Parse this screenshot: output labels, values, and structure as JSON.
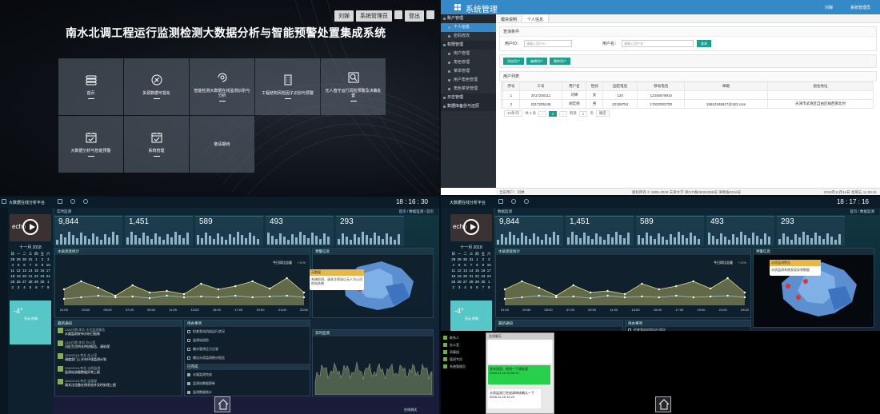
{
  "portal": {
    "user": "刘婵",
    "admin_button": "系统管理员",
    "logout": "登出",
    "title": "南水北调工程运行监测检测大数据分析与智能预警处置集成系统",
    "tiles": [
      {
        "label": "首页",
        "icon": "server-icon"
      },
      {
        "label": "多源数据可视化",
        "icon": "satellite-icon"
      },
      {
        "label": "智能检测大数据在线监测识别与分析",
        "icon": "refresh-eye-icon"
      },
      {
        "label": "工程结构风险因子识别与预警",
        "icon": "building-icon"
      },
      {
        "label": "无人值守运行风险预警及决策处置",
        "icon": "search-icon"
      },
      {
        "label": "大数据分析与智能预警",
        "icon": "calendar-check-icon"
      },
      {
        "label": "系统管理",
        "icon": "calendar-check-icon"
      },
      {
        "label": "敬请期待",
        "icon": ""
      }
    ]
  },
  "admin": {
    "app_title": "系统管理",
    "user": "刘婵",
    "system_admin": "系统管理员",
    "sidebar": [
      {
        "label": "账户管理",
        "type": "group"
      },
      {
        "label": "个人信息",
        "type": "active"
      },
      {
        "label": "密码修改",
        "type": "item"
      },
      {
        "label": "权限管理",
        "type": "group"
      },
      {
        "label": "用户管理",
        "type": "item"
      },
      {
        "label": "角色管理",
        "type": "item"
      },
      {
        "label": "菜单管理",
        "type": "item"
      },
      {
        "label": "用户角色管理",
        "type": "item"
      },
      {
        "label": "角色菜单管理",
        "type": "item"
      },
      {
        "label": "日志管理",
        "type": "group"
      },
      {
        "label": "数据库备份与还原",
        "type": "group"
      }
    ],
    "tabs": [
      "模块说明",
      "个人信息"
    ],
    "search_section": "查询条件",
    "user_id_label": "用户ID：",
    "user_id_placeholder": "请输入用户ID",
    "user_name_label": "用户名：",
    "user_name_placeholder": "请输入用户名",
    "search_btn": "查询",
    "add_btn": "添加用户",
    "edit_btn": "编辑用户",
    "delete_btn": "删除用户",
    "list_title": "用户列表",
    "columns": [
      "序号",
      "工号",
      "用户名",
      "性别",
      "固定电话",
      "移动电话",
      "邮箱",
      "居住地址"
    ],
    "rows": [
      [
        "1",
        "2017200111",
        "刘婵",
        "女",
        "120",
        "12345678910",
        "",
        ""
      ],
      [
        "2",
        "2017205248",
        "胡宏杨",
        "男",
        "22159753",
        "17622002700",
        "18622345617@163.com",
        "天津市武清区自由区翰西南北时"
      ]
    ],
    "pager": {
      "page_size": "10条/页",
      "total": "共 2 条",
      "current": "1",
      "goto_label": "到第",
      "goto_value": "1",
      "goto_unit": "页",
      "confirm": "确定"
    },
    "footer": {
      "left": "当前用户：刘婵",
      "mid": "版权所有 © 1895-2018  天津大学  津ICP备05004358号 津教备0316号",
      "right": "2018年11月16日 星期五 11:00:41"
    }
  },
  "dash1": {
    "platform": "大数据在线分析平台",
    "clock": "18 : 16 : 30",
    "video_text": "echo",
    "section": "实时监测",
    "breadcrumb": "首页 / 数据监测 / 首页",
    "month": "十一月 2018",
    "calendar": [
      [
        "日",
        "一",
        "二",
        "三",
        "四",
        "五",
        "六"
      ],
      [
        "28",
        "29",
        "30",
        "31",
        "1",
        "2",
        "3"
      ],
      [
        "4",
        "5",
        "6",
        "7",
        "8",
        "9",
        "10"
      ],
      [
        "11",
        "12",
        "13",
        "14",
        "15",
        "16",
        "17"
      ],
      [
        "18",
        "19",
        "20",
        "21",
        "22",
        "23",
        "24"
      ],
      [
        "25",
        "26",
        "27",
        "28",
        "29",
        "30",
        "1"
      ],
      [
        "2",
        "3",
        "4",
        "5",
        "6",
        "7",
        "8"
      ]
    ],
    "weather_temp": "-4°",
    "weather_desc": "多云 转晴",
    "kpis": [
      "9,844",
      "1,451",
      "589",
      "493",
      "293"
    ],
    "water_title": "水质测变统计",
    "water_legend": "今日同比总量",
    "water_change": "+12%",
    "water_x": [
      "01:00",
      "03:00",
      "05:00",
      "07:00",
      "09:00",
      "11:00",
      "13:00",
      "15:00",
      "17:00",
      "19:00",
      "21:00",
      "23:00"
    ],
    "map_title": "预警信息",
    "popup_title": "无数据",
    "popup_text": "系统检测，请关注泵站以无人为公司的站系统",
    "notice_title": "最新通知",
    "notices": [
      {
        "meta": "23/6日期-李总 水位监测报告",
        "text": "水量监测发布分析日报表"
      },
      {
        "meta": "24/6日期-李总 办公室",
        "text": "河区生活供水供应报告，请处理"
      },
      {
        "meta": "25/6/2018-李总 办公室",
        "text": "调度部门上半年环境监测计划"
      },
      {
        "meta": "25/6/2018-李总 水质监测",
        "text": "监测站流量数据异常上报"
      },
      {
        "meta": "26/6/2018-李总 运维部",
        "text": "请关注设备在线状态并及时处理上报"
      }
    ],
    "todo_title": "待办事项",
    "todos": [
      "检查泵站机组运行状况",
      "监测站巡检",
      "输水管线压力记录",
      "输出水质监测统计报告"
    ],
    "done_title": "已完成",
    "dones": [
      "水量监测完成",
      "监测站数据更新",
      "监测数据统计"
    ],
    "realtime_title": "实时监测",
    "online": "在线测试"
  },
  "dash2": {
    "platform": "大数据在线分析平台",
    "clock": "18 : 17 : 16",
    "section": "数据监测",
    "breadcrumb": "首页 / 数据监测",
    "kpis": [
      "9,844",
      "1,451",
      "589",
      "493",
      "293"
    ],
    "water_title": "水质测变统计",
    "water_legend": "今日同比总量",
    "water_change": "+12%",
    "map_title": "预警信息",
    "popup_title": "水质监测警告",
    "popup_text": "水质监测系统发现异常数据",
    "notice_title": "最新通知",
    "todo_title": "待办事项",
    "todos": [
      "检查泵站机组运行状况"
    ],
    "contacts": [
      "联系人",
      "办公室",
      "同事组",
      "值班专员",
      "系统管理员"
    ],
    "chat_title": "在线聊天",
    "chat_msgs": [
      {
        "text": "发布消息，收到一下请处理",
        "time": "2018-11-16 10:08:12",
        "green": true
      },
      {
        "text": "水质监测已完成请审核确认一下",
        "time": "2018-11-16 10:21",
        "green": false
      }
    ]
  },
  "colors": {
    "accent": "#3589c6",
    "teal": "#1e9e8d",
    "weather": "#56c6c6",
    "chart_line": "#c8c46a"
  }
}
